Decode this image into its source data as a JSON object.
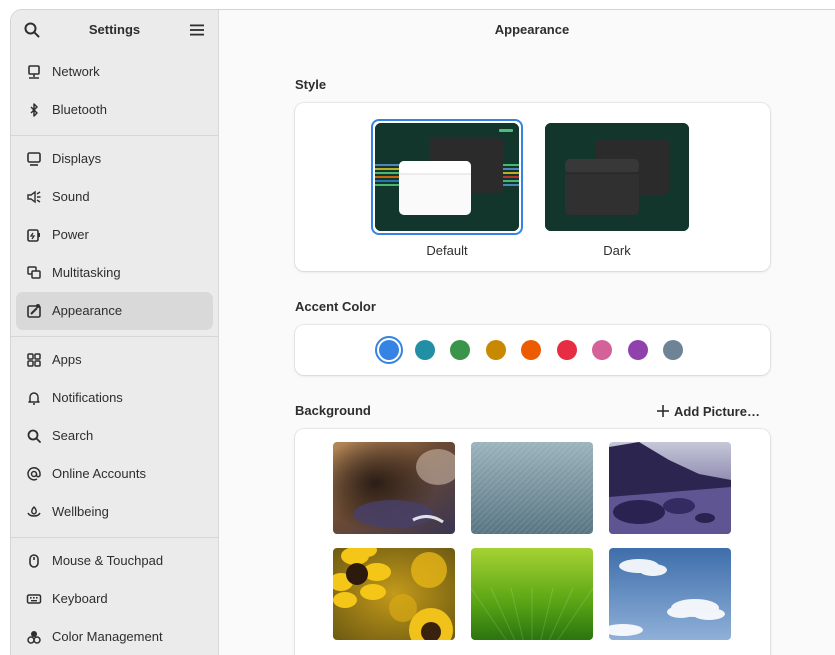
{
  "sidebar": {
    "title": "Settings",
    "groups": [
      [
        {
          "label": "Network",
          "icon": "network-icon"
        },
        {
          "label": "Bluetooth",
          "icon": "bluetooth-icon"
        }
      ],
      [
        {
          "label": "Displays",
          "icon": "display-icon"
        },
        {
          "label": "Sound",
          "icon": "speaker-icon"
        },
        {
          "label": "Power",
          "icon": "power-icon"
        },
        {
          "label": "Multitasking",
          "icon": "multitasking-icon"
        },
        {
          "label": "Appearance",
          "icon": "appearance-icon",
          "active": true
        }
      ],
      [
        {
          "label": "Apps",
          "icon": "apps-grid-icon"
        },
        {
          "label": "Notifications",
          "icon": "bell-icon"
        },
        {
          "label": "Search",
          "icon": "search-icon"
        },
        {
          "label": "Online Accounts",
          "icon": "at-sign-icon"
        },
        {
          "label": "Wellbeing",
          "icon": "wellbeing-icon"
        }
      ],
      [
        {
          "label": "Mouse & Touchpad",
          "icon": "mouse-icon"
        },
        {
          "label": "Keyboard",
          "icon": "keyboard-icon"
        },
        {
          "label": "Color Management",
          "icon": "color-palette-icon"
        }
      ]
    ]
  },
  "header": {
    "title": "Appearance"
  },
  "style": {
    "title": "Style",
    "options": [
      {
        "label": "Default",
        "selected": true
      },
      {
        "label": "Dark",
        "selected": false
      }
    ]
  },
  "accent": {
    "title": "Accent Color",
    "colors": [
      "#3584e4",
      "#2190a4",
      "#3a944a",
      "#c88800",
      "#ed5b00",
      "#e62d42",
      "#d56199",
      "#9141ac",
      "#6f8396"
    ],
    "selected_index": 0
  },
  "background": {
    "title": "Background",
    "add_label": "Add Picture…",
    "wallpapers": [
      "bear",
      "texture",
      "beach",
      "sunflowers",
      "green-rays",
      "clouds"
    ]
  },
  "colors": {
    "accent": "#3584e4",
    "style_bg": "#12352c"
  }
}
